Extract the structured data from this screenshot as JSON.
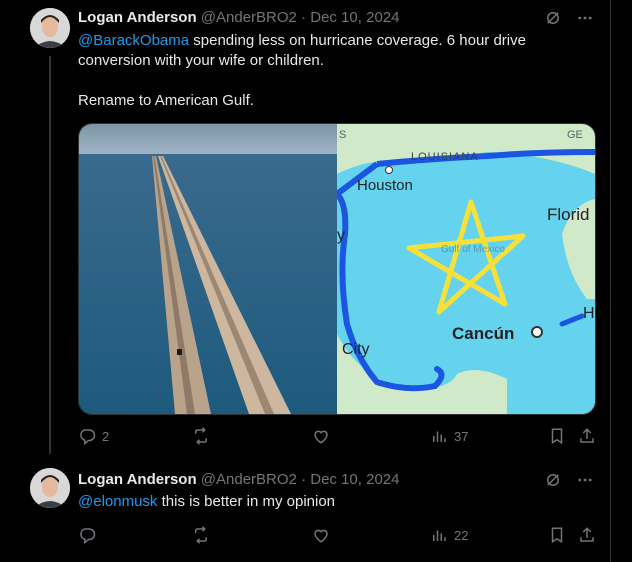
{
  "tweets": [
    {
      "author": "Logan Anderson",
      "handle": "@AnderBRO2",
      "separator": "·",
      "date": "Dec 10, 2024",
      "mention": "@BarackObama",
      "text": " spending less on hurricane coverage. 6 hour drive conversion with your wife or children.",
      "text2": "Rename to American Gulf.",
      "replies": "2",
      "views": "37"
    },
    {
      "author": "Logan Anderson",
      "handle": "@AnderBRO2",
      "separator": "·",
      "date": "Dec 10, 2024",
      "mention": "@elonmusk",
      "text": " this is better in my opinion",
      "views": "22"
    }
  ],
  "map": {
    "labels": {
      "louisiana": "LOUISIANA",
      "houston": "Houston",
      "florida": "Florid",
      "cancun": "Cancún",
      "city": "City",
      "ge": "GE",
      "s": "S",
      "h": "H",
      "y": "y",
      "gulf": "Gulf of Mexico"
    }
  },
  "colors": {
    "background": "#000000",
    "text": "#e7e9ea",
    "muted": "#71767b",
    "link": "#1d9bf0",
    "route": "#1a56e0",
    "star": "#f5e13a",
    "water": "#5fd3f0"
  },
  "icons": [
    "grok-icon",
    "more-icon",
    "reply-icon",
    "retweet-icon",
    "like-icon",
    "views-icon",
    "bookmark-icon",
    "share-icon"
  ]
}
